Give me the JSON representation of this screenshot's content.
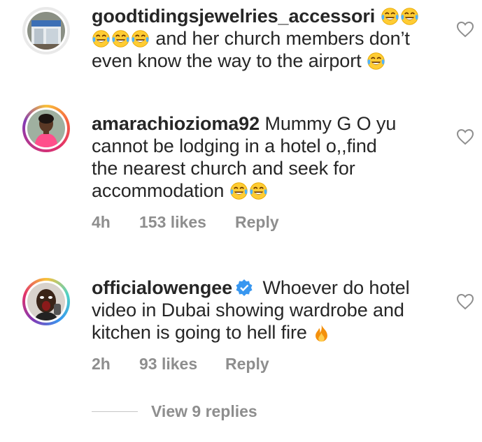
{
  "comments": [
    {
      "username": "goodtidingsjewelries_accessori",
      "text_lines": [
        "",
        "and her church members don’t",
        "even know the way to the airport"
      ],
      "avatar": "shop-storefront-avatar"
    },
    {
      "username": "amarachiozioma92",
      "text_lines": [
        "Mummy G O yu",
        "cannot be lodging in a hotel o,,find",
        "the nearest church and seek for",
        "accommodation"
      ],
      "time": "4h",
      "likes": "153 likes",
      "reply": "Reply",
      "avatar": "woman-pink-top-avatar"
    },
    {
      "username": "officialowengee",
      "verified": true,
      "text_lines": [
        "Whoever do hotel",
        "video in Dubai showing wardrobe and",
        "kitchen is going to hell fire"
      ],
      "time": "2h",
      "likes": "93 likes",
      "reply": "Reply",
      "avatar": "man-shouting-avatar"
    }
  ],
  "view_replies": "View 9 replies",
  "icons": {
    "emoji": "face-with-tears-of-joy-emoji",
    "fire": "fire-emoji",
    "like": "heart-outline-icon",
    "verified": "verified-badge-icon"
  },
  "colors": {
    "meta": "#8e8e8e",
    "verified": "#3897f0",
    "text": "#262626"
  }
}
